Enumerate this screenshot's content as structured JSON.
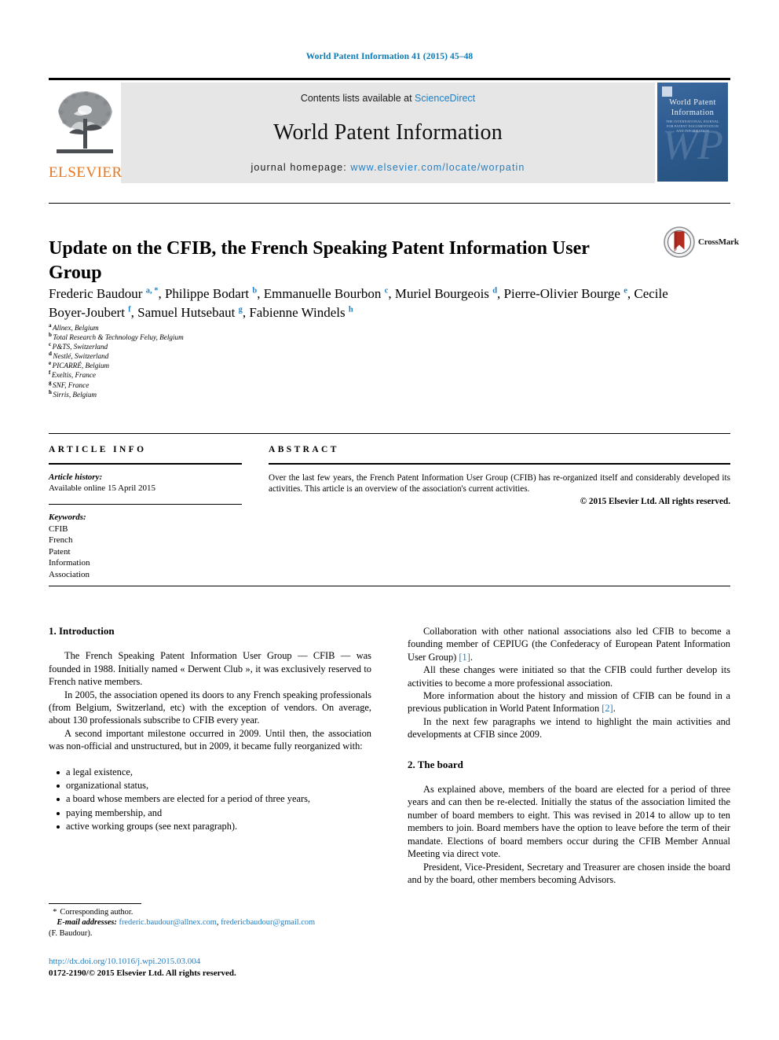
{
  "running_head": "World Patent Information 41 (2015) 45–48",
  "masthead": {
    "publisher_name": "ELSEVIER",
    "contents_prefix": "Contents lists available at ",
    "contents_link": "ScienceDirect",
    "journal_name": "World Patent Information",
    "homepage_prefix": "journal homepage: ",
    "homepage_url": "www.elsevier.com/locate/worpatin",
    "cover": {
      "title_line1": "World Patent",
      "title_line2": "Information",
      "subtitle": "THE INTERNATIONAL JOURNAL FOR PATENT DOCUMENTATION AND INFORMATION",
      "monogram": "WP"
    }
  },
  "article": {
    "title": "Update on the CFIB, the French Speaking Patent Information User Group",
    "crossmark_label": "CrossMark",
    "authors": [
      {
        "name": "Frederic Baudour",
        "marks": "a, *"
      },
      {
        "name": "Philippe Bodart",
        "marks": "b"
      },
      {
        "name": "Emmanuelle Bourbon",
        "marks": "c"
      },
      {
        "name": "Muriel Bourgeois",
        "marks": "d"
      },
      {
        "name": "Pierre-Olivier Bourge",
        "marks": "e"
      },
      {
        "name": "Cecile Boyer-Joubert",
        "marks": "f"
      },
      {
        "name": "Samuel Hutsebaut",
        "marks": "g"
      },
      {
        "name": "Fabienne Windels",
        "marks": "h"
      }
    ],
    "affiliations": [
      {
        "mark": "a",
        "text": "Allnex, Belgium"
      },
      {
        "mark": "b",
        "text": "Total Research & Technology Feluy, Belgium"
      },
      {
        "mark": "c",
        "text": "P&TS, Switzerland"
      },
      {
        "mark": "d",
        "text": "Nestlé, Switzerland"
      },
      {
        "mark": "e",
        "text": "PICARRÉ, Belgium"
      },
      {
        "mark": "f",
        "text": "Exeltis, France"
      },
      {
        "mark": "g",
        "text": "SNF, France"
      },
      {
        "mark": "h",
        "text": "Sirris, Belgium"
      }
    ]
  },
  "article_info": {
    "heading": "ARTICLE INFO",
    "history_label": "Article history:",
    "history_value": "Available online 15 April 2015",
    "keywords_label": "Keywords:",
    "keywords": [
      "CFIB",
      "French",
      "Patent",
      "Information",
      "Association"
    ]
  },
  "abstract": {
    "heading": "ABSTRACT",
    "text": "Over the last few years, the French Patent Information User Group (CFIB) has re-organized itself and considerably developed its activities. This article is an overview of the association's current activities.",
    "copyright": "© 2015 Elsevier Ltd. All rights reserved."
  },
  "body": {
    "left_column": {
      "section_heading": "1. Introduction",
      "paragraphs": [
        "The French Speaking Patent Information User Group — CFIB — was founded in 1988. Initially named « Derwent Club », it was exclusively reserved to French native members.",
        "In 2005, the association opened its doors to any French speaking professionals (from Belgium, Switzerland, etc) with the exception of vendors. On average, about 130 professionals subscribe to CFIB every year.",
        "A second important milestone occurred in 2009. Until then, the association was non-official and unstructured, but in 2009, it became fully reorganized with:"
      ],
      "bullets": [
        "a legal existence,",
        "organizational status,",
        "a board whose members are elected for a period of three years,",
        "paying membership, and",
        "active working groups (see next paragraph)."
      ]
    },
    "right_column": {
      "paragraphs_before": [
        {
          "text": "Collaboration with other national associations also led CFIB to become a founding member of CEPIUG (the Confederacy of European Patent Information User Group) ",
          "ref": "[1]",
          "tail": "."
        },
        {
          "text": "All these changes were initiated so that the CFIB could further develop its activities to become a more professional association.",
          "ref": "",
          "tail": ""
        },
        {
          "text": "More information about the history and mission of CFIB can be found in a previous publication in World Patent Information ",
          "ref": "[2]",
          "tail": "."
        },
        {
          "text": "In the next few paragraphs we intend to highlight the main activities and developments at CFIB since 2009.",
          "ref": "",
          "tail": ""
        }
      ],
      "section_heading": "2. The board",
      "paragraphs_after": [
        "As explained above, members of the board are elected for a period of three years and can then be re-elected. Initially the status of the association limited the number of board members to eight. This was revised in 2014 to allow up to ten members to join. Board members have the option to leave before the term of their mandate. Elections of board members occur during the CFIB Member Annual Meeting via direct vote.",
        "President, Vice-President, Secretary and Treasurer are chosen inside the board and by the board, other members becoming Advisors."
      ]
    }
  },
  "footnote": {
    "star": "*",
    "corresponding": "Corresponding author.",
    "email_label": "E-mail addresses:",
    "email1": "frederic.baudour@allnex.com",
    "email_sep": ", ",
    "email2": "fredericbaudour@gmail.com",
    "attribution": "(F. Baudour)."
  },
  "imprint": {
    "doi": "http://dx.doi.org/10.1016/j.wpi.2015.03.004",
    "issn_line": "0172-2190/© 2015 Elsevier Ltd. All rights reserved."
  },
  "colors": {
    "link": "#1f7fc4",
    "running_head": "#0b7ab5",
    "elsevier_orange": "#e87722",
    "banner_bg": "#e6e6e6",
    "cover_blue": "#2e5c92",
    "crossmark_red": "#b22b20"
  }
}
